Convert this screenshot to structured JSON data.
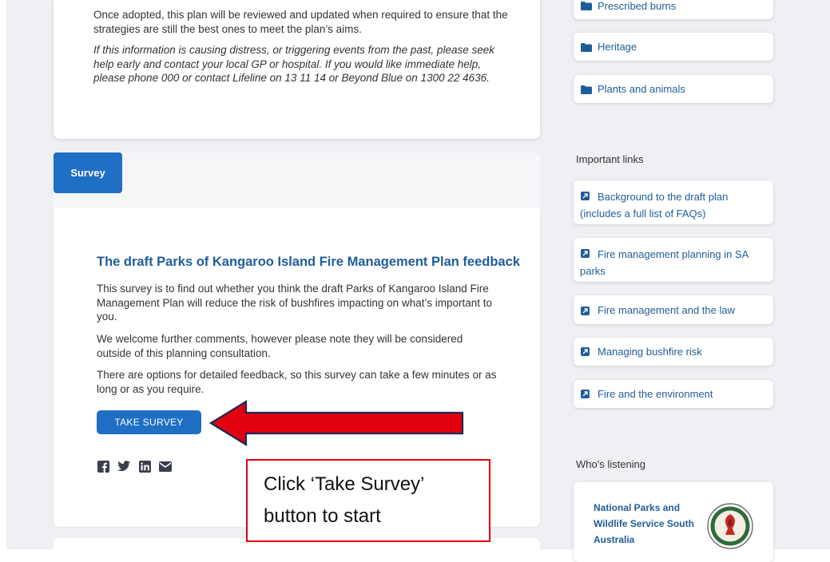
{
  "intro": {
    "paragraph_1": "Once adopted, this plan will be reviewed and updated when required to ensure that the strategies are still the best ones to meet the plan’s aims.",
    "paragraph_2": "If this information is causing distress, or triggering events from the past, please seek help early and contact your local GP or hospital. If you would like immediate help, please phone 000 or contact Lifeline on 13 11 14 or Beyond Blue on 1300 22 4636."
  },
  "survey": {
    "tab_label": "Survey",
    "title": "The draft Parks of Kangaroo Island Fire Management Plan feedback",
    "description_1": "This survey is to find out whether you think the draft Parks of Kangaroo Island Fire Management Plan will reduce the risk of bushfires impacting on what’s important to you.",
    "description_2": "We welcome further comments, however please note they will be considered outside of this planning consultation.",
    "description_3": "There are options for detailed feedback, so this survey can take a few minutes or as long or as you require.",
    "button_label": "TAKE SURVEY",
    "share_icons": [
      "facebook-icon",
      "twitter-icon",
      "linkedin-icon",
      "email-icon"
    ]
  },
  "sidebar": {
    "categories": [
      {
        "label": "Prescribed burns",
        "icon": "folder-icon"
      },
      {
        "label": "Heritage",
        "icon": "folder-icon"
      },
      {
        "label": "Plants and animals",
        "icon": "folder-icon"
      }
    ],
    "important_links_heading": "Important links",
    "important_links": [
      {
        "label": "Background to the draft plan (includes a full list of FAQs)",
        "icon": "external-link-icon"
      },
      {
        "label": "Fire management planning in SA parks",
        "icon": "external-link-icon"
      },
      {
        "label": "Fire management and the law",
        "icon": "external-link-icon"
      },
      {
        "label": "Managing bushfire risk",
        "icon": "external-link-icon"
      },
      {
        "label": "Fire and the environment",
        "icon": "external-link-icon"
      }
    ],
    "whos_listening_heading": "Who's listening",
    "listener_name": "National Parks and Wildlife Service South Australia"
  },
  "annotation": {
    "callout_line_1": "Click ‘Take Survey’",
    "callout_line_2": "button to start",
    "arrow_color": "#e0000e",
    "border_color": "#e0000e"
  },
  "colors": {
    "accent": "#1f6fc4",
    "link": "#1f5d99",
    "background": "#eef0f4"
  }
}
